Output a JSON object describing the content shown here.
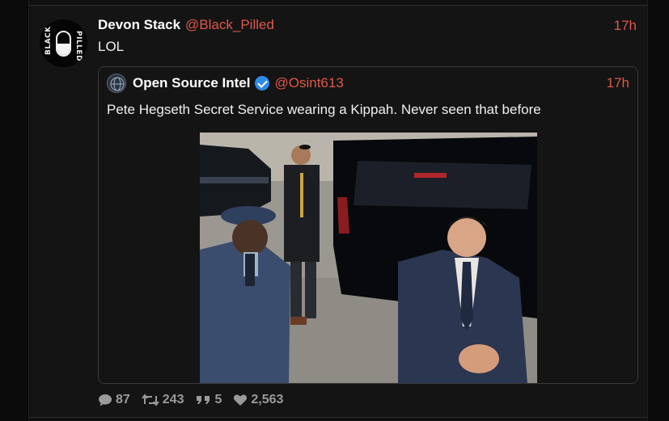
{
  "post": {
    "avatar_text_left": "BLACK",
    "avatar_text_right": "PILLED",
    "display_name": "Devon Stack",
    "handle": "@Black_Pilled",
    "timestamp": "17h",
    "text": "LOL"
  },
  "quoted_post": {
    "display_name": "Open Source Intel",
    "handle": "@Osint613",
    "timestamp": "17h",
    "text": "Pete Hegseth Secret Service wearing a Kippah. Never seen that before",
    "verified_color": "#2d8be8"
  },
  "stats": {
    "replies": "87",
    "retweets": "243",
    "quotes": "5",
    "likes": "2,563"
  },
  "colors": {
    "accent": "#e0574a",
    "background": "#141414",
    "stat_text": "#9a9a9a"
  },
  "icons": {
    "replies": "speech-bubble-icon",
    "retweets": "retweet-icon",
    "quotes": "quote-icon",
    "likes": "heart-icon"
  }
}
